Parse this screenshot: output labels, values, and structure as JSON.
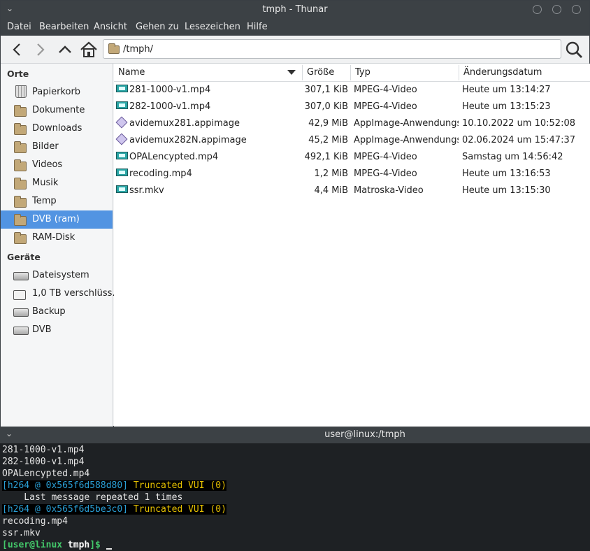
{
  "window": {
    "title": "tmph - Thunar"
  },
  "menu": [
    "Datei",
    "Bearbeiten",
    "Ansicht",
    "Gehen zu",
    "Lesezeichen",
    "Hilfe"
  ],
  "toolbar": {
    "path": "/tmph/"
  },
  "sidebar": {
    "places_heading": "Orte",
    "places": [
      {
        "label": "Papierkorb",
        "icon": "trash-icon"
      },
      {
        "label": "Dokumente",
        "icon": "folder-icon"
      },
      {
        "label": "Downloads",
        "icon": "folder-icon"
      },
      {
        "label": "Bilder",
        "icon": "folder-icon"
      },
      {
        "label": "Videos",
        "icon": "folder-icon"
      },
      {
        "label": "Musik",
        "icon": "folder-icon"
      },
      {
        "label": "Temp",
        "icon": "folder-icon"
      },
      {
        "label": "DVB (ram)",
        "icon": "folder-icon",
        "selected": true
      },
      {
        "label": "RAM-Disk",
        "icon": "folder-icon"
      }
    ],
    "devices_heading": "Geräte",
    "devices": [
      {
        "label": "Dateisystem",
        "icon": "drive-icon"
      },
      {
        "label": "1,0 TB verschlüss…",
        "icon": "encrypted-drive-icon"
      },
      {
        "label": "Backup",
        "icon": "drive-icon"
      },
      {
        "label": "DVB",
        "icon": "drive-icon"
      }
    ]
  },
  "columns": {
    "name": "Name",
    "size": "Größe",
    "type": "Typ",
    "date": "Änderungsdatum"
  },
  "files": [
    {
      "name": "281-1000-v1.mp4",
      "size": "307,1 KiB",
      "type": "MPEG-4-Video",
      "date": "Heute um 13:14:27",
      "icon": "video-icon"
    },
    {
      "name": "282-1000-v1.mp4",
      "size": "307,0 KiB",
      "type": "MPEG-4-Video",
      "date": "Heute um 13:15:23",
      "icon": "video-icon"
    },
    {
      "name": "avidemux281.appimage",
      "size": "42,9 MiB",
      "type": "AppImage-Anwendungspa",
      "date": "10.10.2022 um 10:52:08",
      "icon": "appimage-icon"
    },
    {
      "name": "avidemux282N.appimage",
      "size": "45,2 MiB",
      "type": "AppImage-Anwendungspa",
      "date": "02.06.2024 um 15:47:37",
      "icon": "appimage-icon"
    },
    {
      "name": "OPALencypted.mp4",
      "size": "492,1 KiB",
      "type": "MPEG-4-Video",
      "date": "Samstag um 14:56:42",
      "icon": "video-icon"
    },
    {
      "name": "recoding.mp4",
      "size": "1,2 MiB",
      "type": "MPEG-4-Video",
      "date": "Heute um 13:16:53",
      "icon": "video-icon"
    },
    {
      "name": "ssr.mkv",
      "size": "4,4 MiB",
      "type": "Matroska-Video",
      "date": "Heute um 13:15:30",
      "icon": "video-icon"
    }
  ],
  "terminal": {
    "title": "user@linux:/tmph",
    "lines": {
      "l1": "281-1000-v1.mp4",
      "l2": "282-1000-v1.mp4",
      "l3": "OPALencypted.mp4",
      "l4a": "[h264 @ 0x565f6d588d80]",
      "l4b": " Truncated VUI (0)",
      "l5": "    Last message repeated 1 times",
      "l6a": "[h264 @ 0x565f6d5be3c0]",
      "l6b": " Truncated VUI (0)",
      "l7": "recoding.mp4",
      "l8": "ssr.mkv",
      "p1": "[user@linux",
      "p2": " tmph",
      "p3": "]$"
    }
  }
}
